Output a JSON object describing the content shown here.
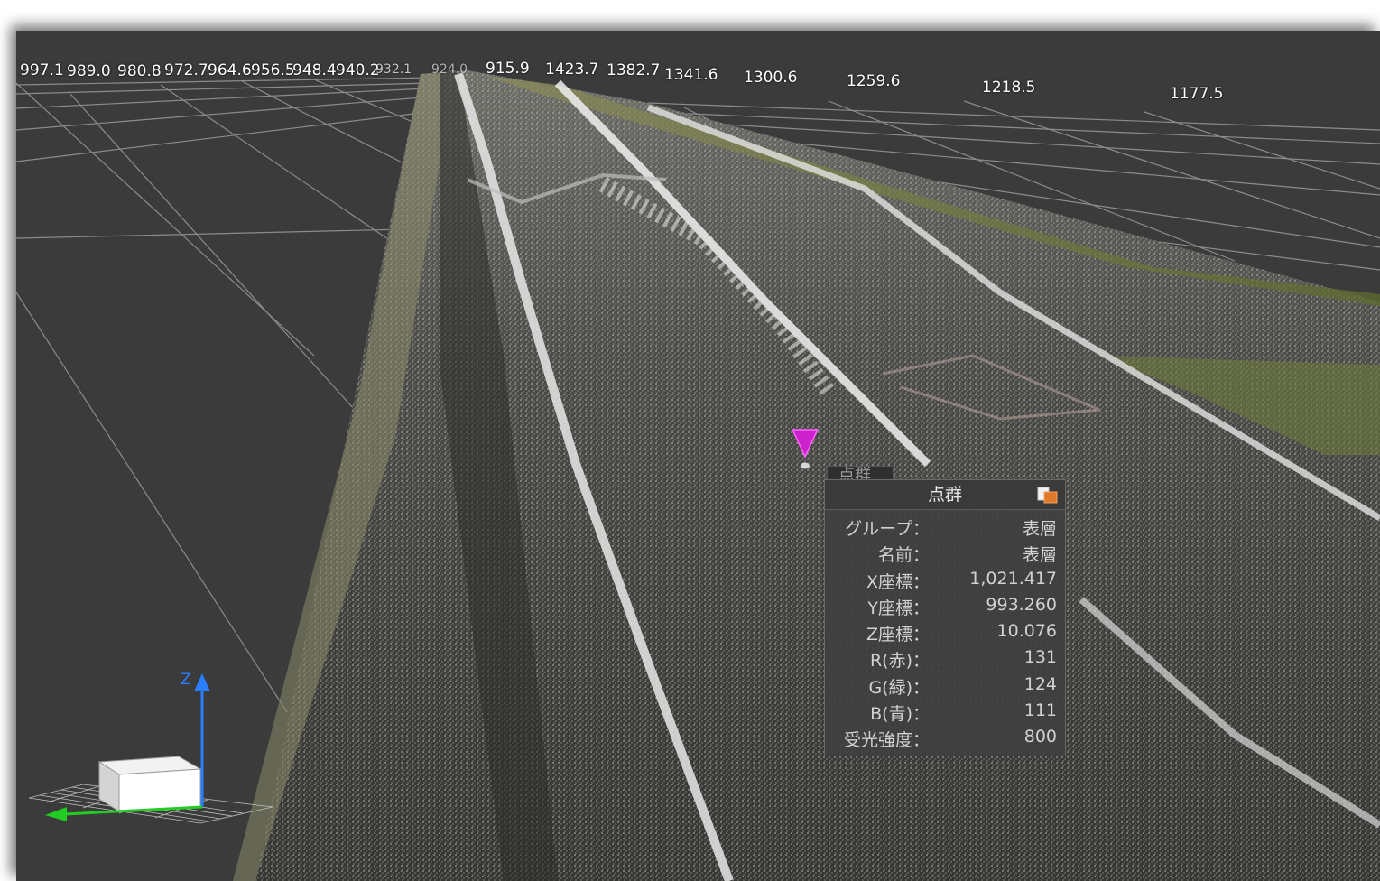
{
  "ruler": {
    "ticks": [
      "997.1",
      "989.0",
      "980.8",
      "972.7",
      "964.6",
      "956.5",
      "948.4",
      "940.2",
      "932.1",
      "924.0",
      "915.9",
      "1423.7",
      "1382.7",
      "1341.6",
      "1300.6",
      "1259.6",
      "1218.5",
      "1177.5"
    ]
  },
  "marker": {
    "color": "#cc22cc"
  },
  "tooltip": {
    "tab_label": "点群",
    "title": "点群",
    "copy_icon": "copy-icon",
    "rows": [
      {
        "label": "グループ：",
        "value": "表層"
      },
      {
        "label": "名前：",
        "value": "表層"
      },
      {
        "label": "X座標：",
        "value": "1,021.417"
      },
      {
        "label": "Y座標：",
        "value": "993.260"
      },
      {
        "label": "Z座標：",
        "value": "10.076"
      },
      {
        "label": "R(赤)：",
        "value": "131"
      },
      {
        "label": "G(緑)：",
        "value": "124"
      },
      {
        "label": "B(青)：",
        "value": "111"
      },
      {
        "label": "受光強度：",
        "value": "800"
      }
    ]
  },
  "gizmo": {
    "z_label": "Z",
    "z_color": "#2a7fff",
    "y_color": "#22cc22"
  }
}
